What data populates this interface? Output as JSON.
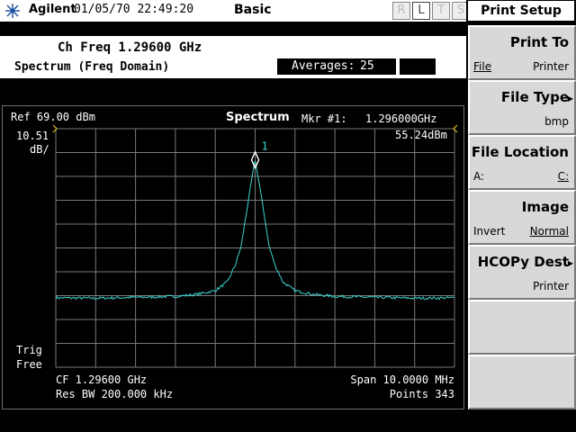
{
  "header": {
    "brand": "Agilent",
    "datetime": "01/05/70 22:49:20",
    "mode": "Basic",
    "status_keys": [
      "R",
      "L",
      "T",
      "S"
    ]
  },
  "info": {
    "channel_freq": "Ch Freq 1.29600 GHz",
    "measurement": "Spectrum (Freq Domain)",
    "averages_label": "Averages:",
    "averages_value": "25"
  },
  "graticule": {
    "ref_level": "Ref 69.00 dBm",
    "scale_value": "10.51",
    "scale_unit": "dB/",
    "view_title": "Spectrum",
    "marker_label": "Mkr #1:",
    "marker_freq": "1.296000GHz",
    "marker_amp": "55.24dBm",
    "marker_number": "1",
    "trig_label": "Trig",
    "trig_value": "Free",
    "center_freq": "CF 1.29600 GHz",
    "res_bw": "Res BW 200.000 kHz",
    "span": "Span  10.0000 MHz",
    "points": "Points 343"
  },
  "chart_data": {
    "type": "line",
    "x_unit": "MHz offset from center",
    "xlim": [
      -5,
      5
    ],
    "ylim": [
      -36.1,
      69.0
    ],
    "reference_level": 69.0,
    "scale_per_div": 10.51,
    "series": [
      {
        "x": [
          -5.0,
          -4.0,
          -3.0,
          -2.0,
          -1.5,
          -1.0,
          -0.7,
          -0.5,
          -0.35,
          -0.2,
          -0.1,
          0.0,
          0.1,
          0.2,
          0.35,
          0.5,
          0.7,
          1.0,
          1.5,
          2.0,
          3.0,
          4.0,
          5.0
        ],
        "y": [
          -5.5,
          -5.7,
          -5.3,
          -4.9,
          -4.1,
          -2.4,
          1.4,
          8.8,
          17.3,
          34.0,
          45.0,
          55.2,
          45.0,
          34.0,
          17.3,
          8.8,
          1.4,
          -2.4,
          -4.1,
          -4.9,
          -5.3,
          -5.7,
          -5.5
        ]
      }
    ],
    "marker": {
      "x": 0.0,
      "y": 55.24
    }
  },
  "softkeys": {
    "title": "Print Setup",
    "keys": [
      {
        "label": "Print To",
        "left": "File",
        "right": "Printer"
      },
      {
        "label": "File Type",
        "left": "",
        "right": "bmp"
      },
      {
        "label": "File Location",
        "left": "A:",
        "right": "C:"
      },
      {
        "label": "Image",
        "left": "Invert",
        "right": "Normal"
      },
      {
        "label": "HCOPy Dest",
        "left": "",
        "right": "Printer"
      },
      {
        "label": "",
        "left": "",
        "right": ""
      },
      {
        "label": "",
        "left": "",
        "right": ""
      }
    ]
  },
  "colors": {
    "trace": "#3ad6d0",
    "grid": "#7a7a7a",
    "marker": "#ffffff",
    "ref_tick": "#e0c020"
  }
}
